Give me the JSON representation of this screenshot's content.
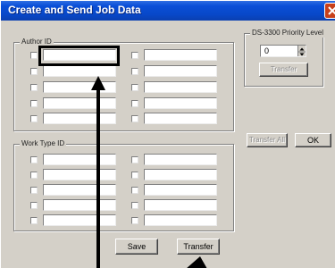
{
  "window": {
    "title": "Create and Send Job Data",
    "close_icon": "close-icon"
  },
  "author_group": {
    "label": "Author ID"
  },
  "worktype_group": {
    "label": "Work Type ID"
  },
  "priority_group": {
    "label": "DS-3300 Priority Level",
    "value": "0",
    "transfer_label": "Transfer"
  },
  "buttons": {
    "transfer_all": "Transfer All",
    "ok": "OK",
    "save": "Save",
    "transfer": "Transfer"
  },
  "colors": {
    "titlebar": "#0a4fd8",
    "dialog_bg": "#d4d0c8",
    "annotation": "#000000"
  }
}
